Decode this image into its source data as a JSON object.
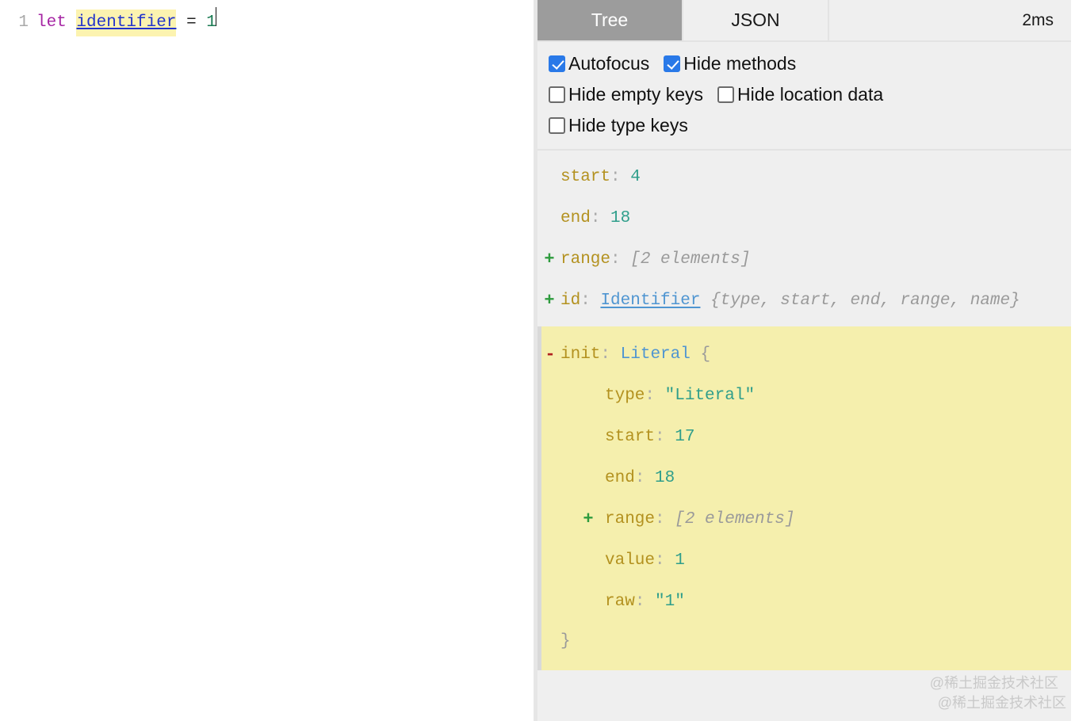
{
  "editor": {
    "line_number": "1",
    "tokens": {
      "keyword": "let",
      "identifier": "identifier",
      "operator": "=",
      "number": "1"
    },
    "full_source": "let identifier = 1"
  },
  "panel": {
    "tabs": [
      {
        "label": "Tree",
        "active": true
      },
      {
        "label": "JSON",
        "active": false
      }
    ],
    "timing": "2ms",
    "options": [
      {
        "label": "Autofocus",
        "checked": true
      },
      {
        "label": "Hide methods",
        "checked": true
      },
      {
        "label": "Hide empty keys",
        "checked": false
      },
      {
        "label": "Hide location data",
        "checked": false
      },
      {
        "label": "Hide type keys",
        "checked": false
      }
    ]
  },
  "tree": {
    "top_nodes": [
      {
        "marker": "",
        "key": "start",
        "value": "4",
        "value_kind": "number"
      },
      {
        "marker": "",
        "key": "end",
        "value": "18",
        "value_kind": "number"
      },
      {
        "marker": "+",
        "key": "range",
        "preview": "[2 elements]"
      },
      {
        "marker": "+",
        "key": "id",
        "link": "Identifier",
        "preview": "{type, start, end, range, name}"
      }
    ],
    "highlighted": {
      "marker": "-",
      "key": "init",
      "type_name": "Literal",
      "open_brace": "{",
      "close_brace": "}",
      "children": [
        {
          "marker": "",
          "key": "type",
          "value": "\"Literal\"",
          "value_kind": "string"
        },
        {
          "marker": "",
          "key": "start",
          "value": "17",
          "value_kind": "number"
        },
        {
          "marker": "",
          "key": "end",
          "value": "18",
          "value_kind": "number"
        },
        {
          "marker": "+",
          "key": "range",
          "preview": "[2 elements]"
        },
        {
          "marker": "",
          "key": "value",
          "value": "1",
          "value_kind": "number"
        },
        {
          "marker": "",
          "key": "raw",
          "value": "\"1\"",
          "value_kind": "string"
        }
      ]
    }
  },
  "watermark": {
    "line1": "@稀土掘金技术社区",
    "line2": "@稀土掘金技术社区"
  },
  "colors": {
    "tab_active_bg": "#9c9c9c",
    "checkbox_checked": "#2979e8",
    "panel_bg": "#efefef",
    "highlight_bg": "#f5efad",
    "key": "#b3911f",
    "value": "#2f9e8b",
    "link": "#4f95d1",
    "marker_plus": "#2e9b3e",
    "marker_minus": "#b02020",
    "editor_keyword": "#a626a4",
    "editor_identifier": "#2233cc",
    "editor_identifier_bg": "#fcf3b0",
    "editor_number": "#1a7a52"
  }
}
